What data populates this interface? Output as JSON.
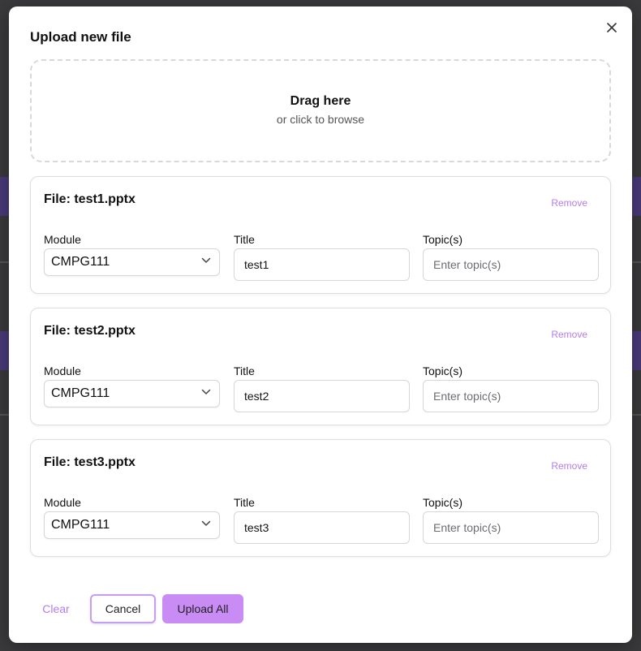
{
  "modal": {
    "title": "Upload new file",
    "close_icon": "close-icon"
  },
  "dropzone": {
    "main_text": "Drag here",
    "sub_text": "or click to browse"
  },
  "labels": {
    "module": "Module",
    "title": "Title",
    "topics": "Topic(s)",
    "remove": "Remove"
  },
  "files": [
    {
      "heading": "File: test1.pptx",
      "module": "CMPG111",
      "title": "test1",
      "topics_placeholder": "Enter topic(s)"
    },
    {
      "heading": "File: test2.pptx",
      "module": "CMPG111",
      "title": "test2",
      "topics_placeholder": "Enter topic(s)"
    },
    {
      "heading": "File: test3.pptx",
      "module": "CMPG111",
      "title": "test3",
      "topics_placeholder": "Enter topic(s)"
    }
  ],
  "footer": {
    "clear_label": "Clear",
    "cancel_label": "Cancel",
    "upload_label": "Upload All"
  },
  "colors": {
    "accent": "#b57cf0",
    "upload_button": "#c98cf5",
    "cancel_border": "#c79cf2"
  }
}
